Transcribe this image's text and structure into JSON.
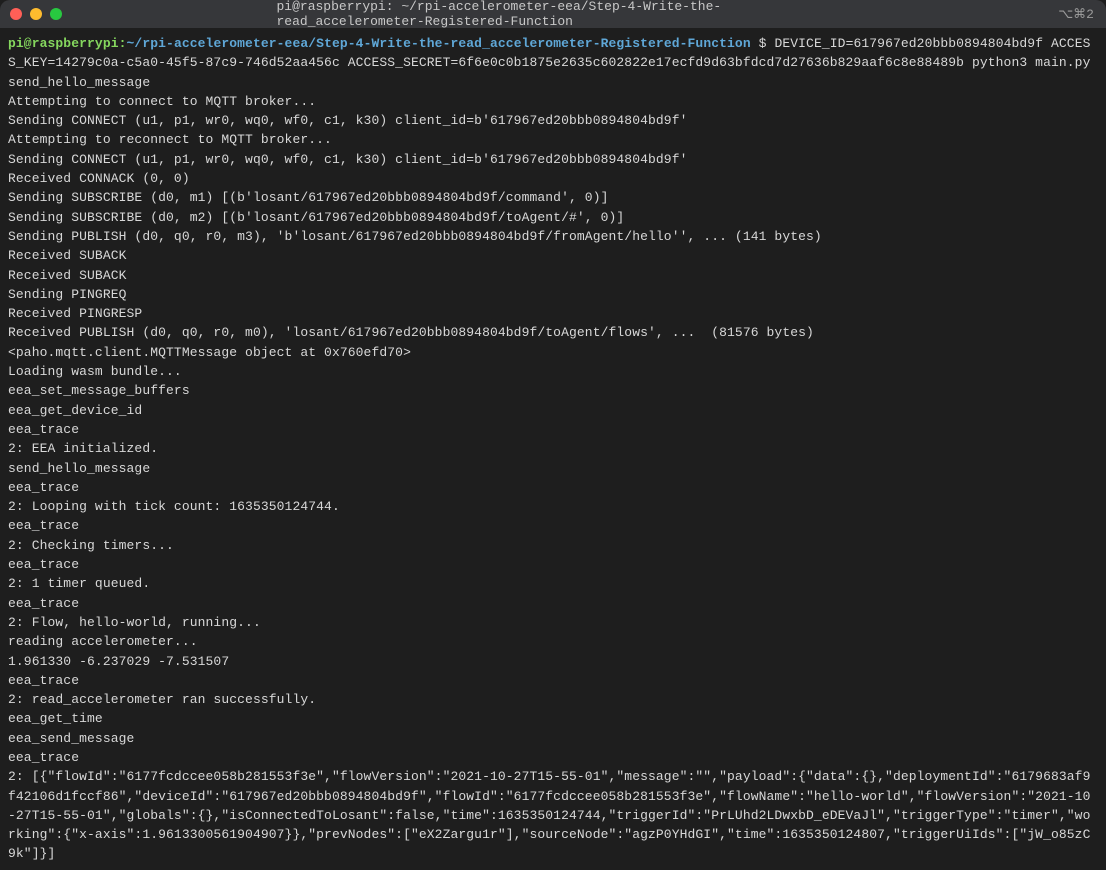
{
  "window": {
    "title": "pi@raspberrypi: ~/rpi-accelerometer-eea/Step-4-Write-the-read_accelerometer-Registered-Function",
    "tab_indicator": "⌥⌘2"
  },
  "prompt": {
    "user_host": "pi@raspberrypi",
    "separator": ":",
    "path": "~/rpi-accelerometer-eea/Step-4-Write-the-read_accelerometer-Registered-Function",
    "dollar": " $ "
  },
  "command": "DEVICE_ID=617967ed20bbb0894804bd9f ACCESS_KEY=14279c0a-c5a0-45f5-87c9-746d52aa456c ACCESS_SECRET=6f6e0c0b1875e2635c602822e17ecfd9d63bfdcd7d27636b829aaf6c8e88489b python3 main.py",
  "output_lines": [
    "send_hello_message",
    "Attempting to connect to MQTT broker...",
    "Sending CONNECT (u1, p1, wr0, wq0, wf0, c1, k30) client_id=b'617967ed20bbb0894804bd9f'",
    "Attempting to reconnect to MQTT broker...",
    "Sending CONNECT (u1, p1, wr0, wq0, wf0, c1, k30) client_id=b'617967ed20bbb0894804bd9f'",
    "Received CONNACK (0, 0)",
    "Sending SUBSCRIBE (d0, m1) [(b'losant/617967ed20bbb0894804bd9f/command', 0)]",
    "Sending SUBSCRIBE (d0, m2) [(b'losant/617967ed20bbb0894804bd9f/toAgent/#', 0)]",
    "Sending PUBLISH (d0, q0, r0, m3), 'b'losant/617967ed20bbb0894804bd9f/fromAgent/hello'', ... (141 bytes)",
    "Received SUBACK",
    "Received SUBACK",
    "Sending PINGREQ",
    "Received PINGRESP",
    "Received PUBLISH (d0, q0, r0, m0), 'losant/617967ed20bbb0894804bd9f/toAgent/flows', ...  (81576 bytes)",
    "<paho.mqtt.client.MQTTMessage object at 0x760efd70>",
    "Loading wasm bundle...",
    "eea_set_message_buffers",
    "eea_get_device_id",
    "eea_trace",
    "2: EEA initialized.",
    "send_hello_message",
    "eea_trace",
    "2: Looping with tick count: 1635350124744.",
    "eea_trace",
    "2: Checking timers...",
    "eea_trace",
    "2: 1 timer queued.",
    "eea_trace",
    "2: Flow, hello-world, running...",
    "reading accelerometer...",
    "1.961330 -6.237029 -7.531507",
    "eea_trace",
    "2: read_accelerometer ran successfully.",
    "eea_get_time",
    "eea_send_message",
    "eea_trace",
    "2: [{\"flowId\":\"6177fcdccee058b281553f3e\",\"flowVersion\":\"2021-10-27T15-55-01\",\"message\":\"\",\"payload\":{\"data\":{},\"deploymentId\":\"6179683af9f42106d1fccf86\",\"deviceId\":\"617967ed20bbb0894804bd9f\",\"flowId\":\"6177fcdccee058b281553f3e\",\"flowName\":\"hello-world\",\"flowVersion\":\"2021-10-27T15-55-01\",\"globals\":{},\"isConnectedToLosant\":false,\"time\":1635350124744,\"triggerId\":\"PrLUhd2LDwxbD_eDEVaJl\",\"triggerType\":\"timer\",\"working\":{\"x-axis\":1.9613300561904907}},\"prevNodes\":[\"eX2Zargu1r\"],\"sourceNode\":\"agzP0YHdGI\",\"time\":1635350124807,\"triggerUiIds\":[\"jW_o85zC9k\"]}]"
  ]
}
